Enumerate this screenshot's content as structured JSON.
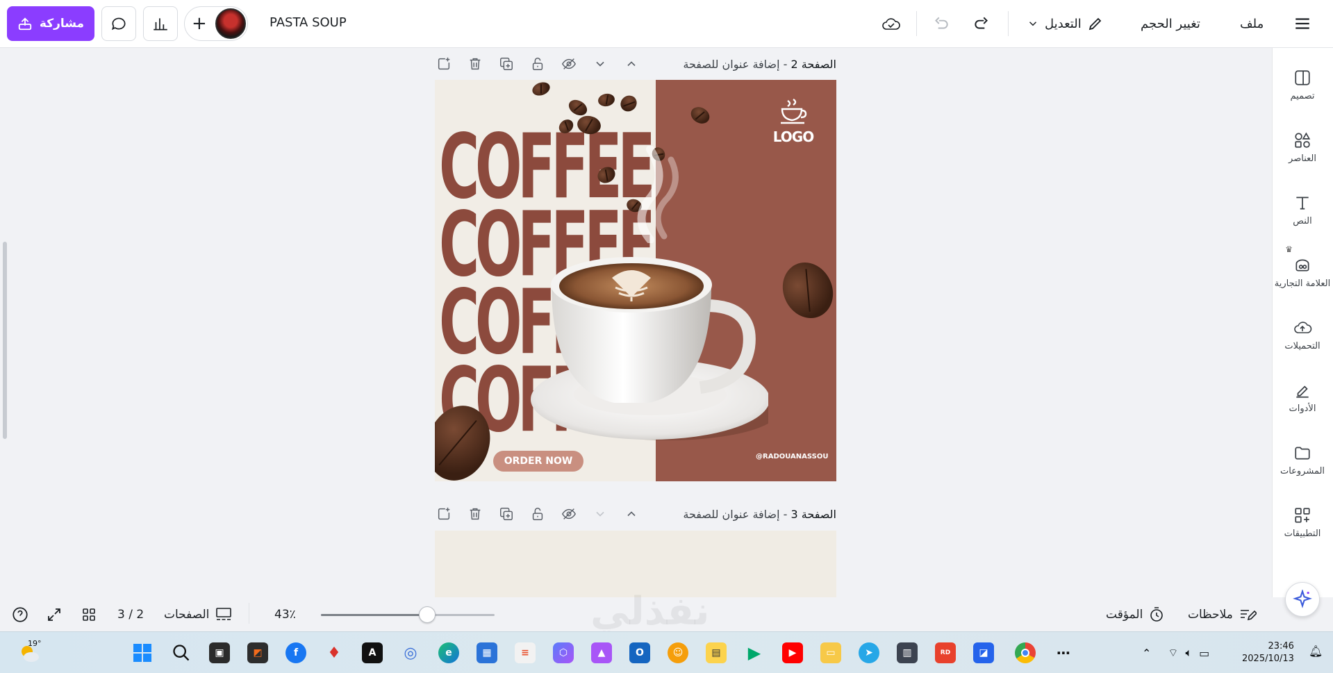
{
  "topbar": {
    "share_label": "مشاركة",
    "project_title": "PASTA SOUP",
    "edit_label": "التعديل",
    "resize_label": "تغيير الحجم",
    "file_label": "ملف"
  },
  "sidepanel": {
    "items": [
      {
        "label": "تصميم",
        "icon": "layout-icon"
      },
      {
        "label": "العناصر",
        "icon": "shapes-icon"
      },
      {
        "label": "النص",
        "icon": "text-icon"
      },
      {
        "label": "العلامة التجارية",
        "icon": "brand-icon"
      },
      {
        "label": "التحميلات",
        "icon": "cloud-upload-icon"
      },
      {
        "label": "الأدوات",
        "icon": "pen-tool-icon"
      },
      {
        "label": "المشروعات",
        "icon": "folder-icon"
      },
      {
        "label": "التطبيقات",
        "icon": "apps-grid-icon"
      }
    ]
  },
  "pages": [
    {
      "page_label": "الصفحة 2",
      "separator": " - ",
      "title_placeholder": "إضافة عنوان للصفحة"
    },
    {
      "page_label": "الصفحة 3",
      "separator": " - ",
      "title_placeholder": "إضافة عنوان للصفحة"
    }
  ],
  "design": {
    "headline": "COFFEE",
    "logo_text": "LOGO",
    "cta": "ORDER NOW",
    "handle": "@RADOUANASSOU",
    "colors": {
      "panel": "#98584a",
      "headline": "#8c4a3d",
      "cream": "#f1ede6",
      "cta": "#c98f80"
    }
  },
  "bottombar": {
    "notes_label": "ملاحظات",
    "timer_label": "المؤقت",
    "zoom": "43٪",
    "zoom_fraction": 0.43,
    "pages_label": "الصفحات",
    "page_counter": "3 / 2"
  },
  "watermark": "نفذلي",
  "taskbar": {
    "weather_temp": "19°",
    "time": "23:46",
    "date": "2025/10/13"
  }
}
